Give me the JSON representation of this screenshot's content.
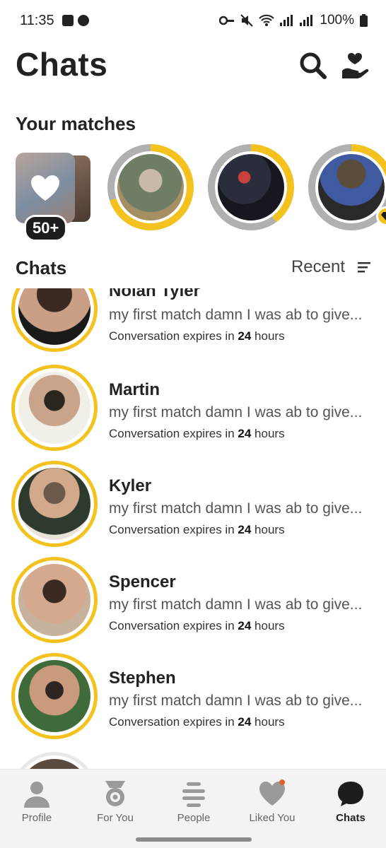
{
  "status_bar": {
    "time": "11:35",
    "battery": "100%"
  },
  "header": {
    "title": "Chats",
    "search_icon": "search-icon",
    "gift_icon": "heart-hand-icon"
  },
  "matches": {
    "title": "Your matches",
    "likes_badge": "50+",
    "ring_color": "#f3c21f",
    "ring_track_color": "#b0b0b0",
    "items": [
      {
        "progress": 0.7
      },
      {
        "progress": 0.4
      },
      {
        "progress": 0.25,
        "badge_icon": "diamond-icon"
      }
    ]
  },
  "chats": {
    "title": "Chats",
    "sort_label": "Recent",
    "sort_icon": "sort-lines-icon",
    "items": [
      {
        "name": "Nolan Tyler",
        "message": "my first match damn I was ab to give...",
        "expires_prefix": "Conversation expires in",
        "expires_value": "24",
        "expires_unit": "hours"
      },
      {
        "name": "Martin",
        "message": "my first match damn I was ab to give...",
        "expires_prefix": "Conversation expires in",
        "expires_value": "24",
        "expires_unit": "hours"
      },
      {
        "name": "Kyler",
        "message": "my first match damn I was ab to give...",
        "expires_prefix": "Conversation expires in",
        "expires_value": "24",
        "expires_unit": "hours"
      },
      {
        "name": "Spencer",
        "message": "my first match damn I was ab to give...",
        "expires_prefix": "Conversation expires in",
        "expires_value": "24",
        "expires_unit": "hours"
      },
      {
        "name": "Stephen",
        "message": "my first match damn I was ab to give...",
        "expires_prefix": "Conversation expires in",
        "expires_value": "24",
        "expires_unit": "hours"
      }
    ]
  },
  "nav": {
    "items": [
      {
        "label": "Profile",
        "icon": "person-icon"
      },
      {
        "label": "For You",
        "icon": "medal-icon"
      },
      {
        "label": "People",
        "icon": "stack-lines-icon"
      },
      {
        "label": "Liked You",
        "icon": "heart-icon"
      },
      {
        "label": "Chats",
        "icon": "chat-bubble-icon"
      }
    ],
    "active": "Chats"
  },
  "colors": {
    "accent": "#f3c21f",
    "text": "#222222",
    "nav_bg": "#f3f3f3"
  }
}
